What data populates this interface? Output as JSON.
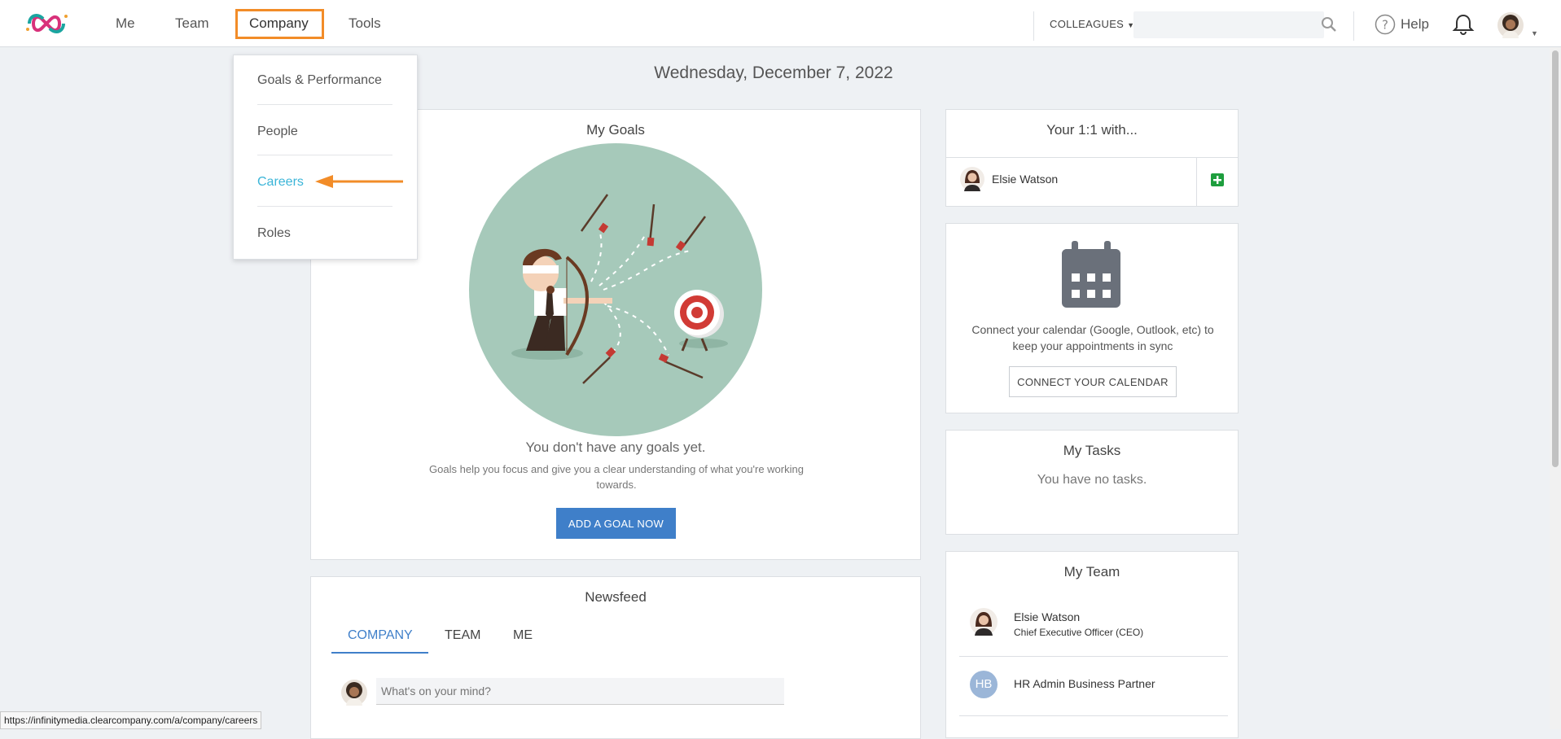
{
  "nav": {
    "items": [
      {
        "label": "Me"
      },
      {
        "label": "Team"
      },
      {
        "label": "Company"
      },
      {
        "label": "Tools"
      }
    ],
    "colleagues_label": "COLLEAGUES",
    "search_placeholder": "",
    "help_label": "Help"
  },
  "date_title": "Wednesday, December 7, 2022",
  "company_menu": {
    "items": [
      {
        "label": "Goals & Performance"
      },
      {
        "label": "People"
      },
      {
        "label": "Careers",
        "active": true
      },
      {
        "label": "Roles"
      }
    ]
  },
  "goals": {
    "title": "My Goals",
    "empty_heading": "You don't have any goals yet.",
    "description": "Goals help you focus and give you a clear understanding of what you're working towards.",
    "button_label": "ADD A GOAL NOW"
  },
  "newsfeed": {
    "title": "Newsfeed",
    "tabs": [
      {
        "label": "COMPANY",
        "active": true
      },
      {
        "label": "TEAM"
      },
      {
        "label": "ME"
      }
    ],
    "input_placeholder": "What's on your mind?"
  },
  "one_on_one": {
    "title": "Your 1:1 with...",
    "person_name": "Elsie Watson"
  },
  "calendar": {
    "text": "Connect your calendar (Google, Outlook, etc) to keep your appointments in sync",
    "button_label": "CONNECT YOUR CALENDAR"
  },
  "tasks": {
    "title": "My Tasks",
    "empty_text": "You have no tasks."
  },
  "team": {
    "title": "My Team",
    "members": [
      {
        "name": "Elsie Watson",
        "role": "Chief Executive Officer (CEO)"
      },
      {
        "name": "HR Admin Business Partner",
        "initials": "HB"
      }
    ]
  },
  "status_url": "https://infinitymedia.clearcompany.com/a/company/careers",
  "colors": {
    "accent_blue": "#3f7fc9",
    "highlight_orange": "#f28c28",
    "menu_active": "#3bb5d8",
    "add_green": "#1e9e3e"
  },
  "icons": [
    "infinity-logo-icon",
    "search-icon",
    "help-circle-icon",
    "bell-icon",
    "calendar-icon",
    "plus-square-icon",
    "arrow-left-icon"
  ]
}
